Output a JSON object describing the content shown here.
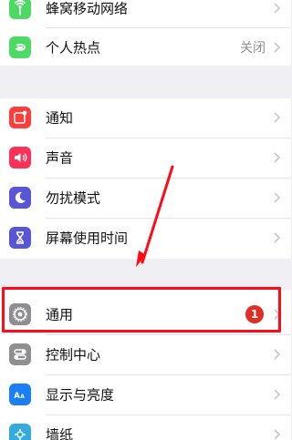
{
  "settings": {
    "group1": [
      {
        "label": "蜂窝移动网络",
        "icon": "cellular-antenna-icon",
        "color": "#4cd964",
        "value": ""
      },
      {
        "label": "个人热点",
        "icon": "personal-hotspot-icon",
        "color": "#4cd964",
        "value": "关闭"
      }
    ],
    "group2": [
      {
        "label": "通知",
        "icon": "notifications-icon",
        "color": "#fc3d39"
      },
      {
        "label": "声音",
        "icon": "sounds-icon",
        "color": "#fc3158"
      },
      {
        "label": "勿扰模式",
        "icon": "moon-icon",
        "color": "#5856d6"
      },
      {
        "label": "屏幕使用时间",
        "icon": "hourglass-icon",
        "color": "#5856d6"
      }
    ],
    "group3": [
      {
        "label": "通用",
        "icon": "gear-icon",
        "color": "#8e8e93",
        "badge": "1"
      },
      {
        "label": "控制中心",
        "icon": "control-center-icon",
        "color": "#8e8e93"
      },
      {
        "label": "显示与亮度",
        "icon": "display-brightness-icon",
        "color": "#1a7ef5"
      },
      {
        "label": "墙纸",
        "icon": "wallpaper-icon",
        "color": "#35aadc"
      }
    ]
  },
  "annotation": {
    "highlight_color": "#ff0a16",
    "arrow_color": "#ff0a16"
  }
}
